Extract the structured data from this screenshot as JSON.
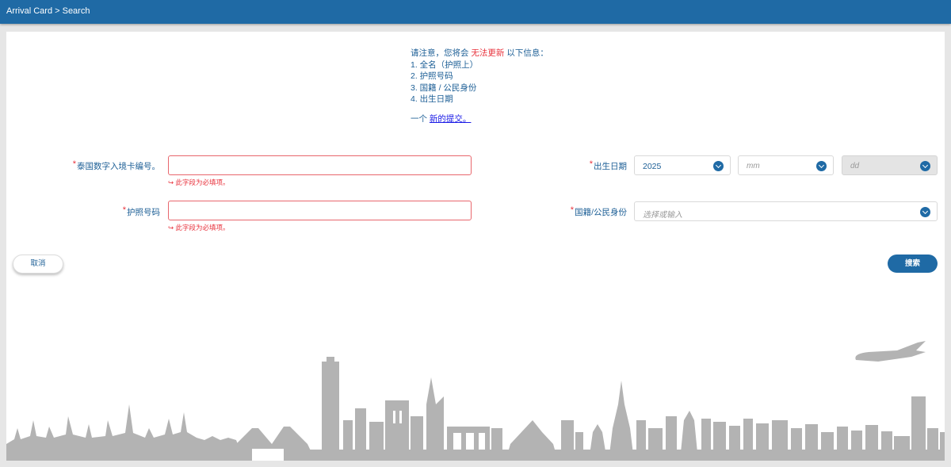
{
  "topbar": {
    "breadcrumb": "Arrival Card > Search"
  },
  "notice": {
    "intro_prefix": "请注意，您将会 ",
    "intro_warning": "无法更新",
    "intro_suffix": " 以下信息：",
    "items": [
      "1. 全名（护照上）",
      "2. 护照号码",
      "3. 国籍 / 公民身份",
      "4. 出生日期"
    ],
    "resubmit_prefix": "一个 ",
    "resubmit_link": "新的提交。"
  },
  "form": {
    "required_mark": "*",
    "card_number": {
      "label": "泰国数字入境卡编号。",
      "value": "",
      "error": "↪ 此字段为必填项。"
    },
    "passport": {
      "label": "护照号码",
      "value": "",
      "error": "↪ 此字段为必填项。"
    },
    "dob": {
      "label": "出生日期",
      "year": "2025",
      "month_placeholder": "mm",
      "day_placeholder": "dd"
    },
    "nationality": {
      "label": "国籍/公民身份",
      "placeholder": "选择或输入"
    }
  },
  "actions": {
    "cancel": "取消",
    "search": "搜索"
  },
  "icons": {
    "dropdown": "chevron-down-icon"
  },
  "colors": {
    "primary": "#1f6aa5",
    "error": "#e8323c",
    "link": "#1a1ae6",
    "skyline": "#b3b3b3"
  }
}
